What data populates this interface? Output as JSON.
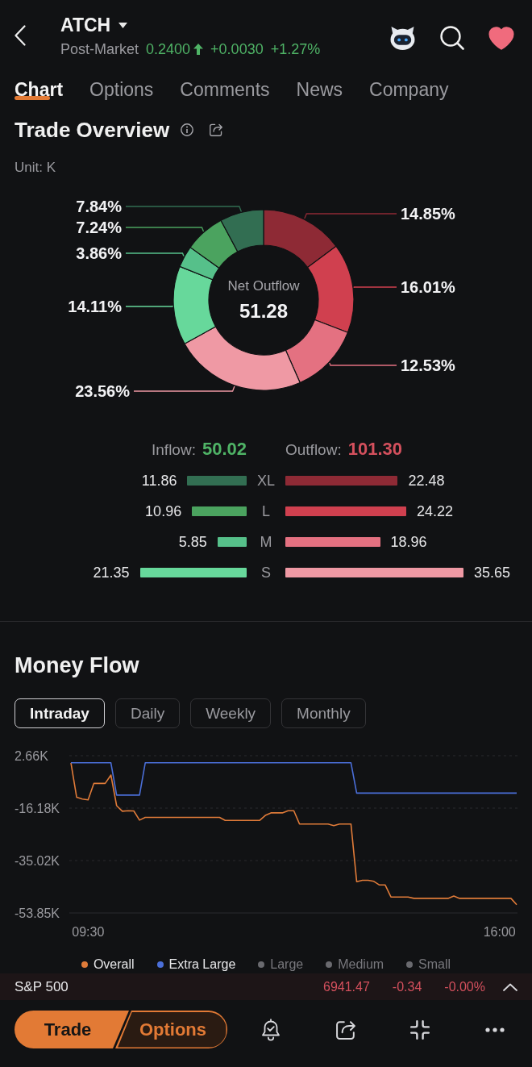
{
  "header": {
    "symbol": "ATCH",
    "session": "Post-Market",
    "price": "0.2400",
    "change": "+0.0030",
    "change_percent": "+1.27%",
    "favorited": true
  },
  "tabs": [
    {
      "label": "Chart",
      "selected": true
    },
    {
      "label": "Options",
      "selected": false
    },
    {
      "label": "Comments",
      "selected": false
    },
    {
      "label": "News",
      "selected": false
    },
    {
      "label": "Company",
      "selected": false
    }
  ],
  "trade_overview": {
    "title": "Trade Overview",
    "unit": "Unit: K",
    "center_label": "Net Outflow",
    "center_value": "51.28",
    "chart_data": {
      "type": "donut",
      "values": [
        14.85,
        16.01,
        12.53,
        23.56,
        14.11,
        3.86,
        7.24,
        7.84
      ],
      "value_labels": [
        "14.85%",
        "16.01%",
        "12.53%",
        "23.56%",
        "14.11%",
        "3.86%",
        "7.24%",
        "7.84%"
      ],
      "colors": [
        "#8e2a35",
        "#d0404f",
        "#e47181",
        "#ef99a4",
        "#67d89b",
        "#56c08a",
        "#4ba35f",
        "#326e52"
      ]
    }
  },
  "flows": {
    "inflow_label": "Inflow:",
    "inflow_total": "50.02",
    "outflow_label": "Outflow:",
    "outflow_total": "101.30",
    "rows": [
      {
        "size": "XL",
        "inflow": {
          "value": "11.86",
          "level": 0.333,
          "color": "#326e52"
        },
        "outflow": {
          "value": "22.48",
          "level": 0.631,
          "color": "#8e2a35"
        }
      },
      {
        "size": "L",
        "inflow": {
          "value": "10.96",
          "level": 0.307,
          "color": "#4ba35f"
        },
        "outflow": {
          "value": "24.22",
          "level": 0.679,
          "color": "#d0404f"
        }
      },
      {
        "size": "M",
        "inflow": {
          "value": "5.85",
          "level": 0.164,
          "color": "#56c08a"
        },
        "outflow": {
          "value": "18.96",
          "level": 0.532,
          "color": "#e47181"
        }
      },
      {
        "size": "S",
        "inflow": {
          "value": "21.35",
          "level": 0.599,
          "color": "#67d89b"
        },
        "outflow": {
          "value": "35.65",
          "level": 1.0,
          "color": "#ef99a4"
        }
      }
    ]
  },
  "money_flow": {
    "title": "Money Flow",
    "periods": [
      {
        "label": "Intraday",
        "selected": true
      },
      {
        "label": "Daily",
        "selected": false
      },
      {
        "label": "Weekly",
        "selected": false
      },
      {
        "label": "Monthly",
        "selected": false
      }
    ],
    "chart_data": {
      "type": "line",
      "categories": [
        null,
        null,
        null,
        "09:30",
        null,
        null,
        null,
        null,
        null,
        null,
        null,
        null,
        null,
        null,
        null,
        null,
        null,
        null,
        null,
        null,
        null,
        null,
        null,
        null,
        null,
        null,
        null,
        null,
        null,
        null,
        null,
        null,
        null,
        null,
        null,
        null,
        null,
        null,
        null,
        null,
        null,
        null,
        null,
        null,
        null,
        null,
        null,
        null,
        null,
        null,
        null,
        null,
        null,
        null,
        null,
        null,
        null,
        null,
        null,
        null,
        null,
        null,
        null,
        null,
        null,
        null,
        null,
        null,
        null,
        null,
        null,
        null,
        null,
        null,
        null,
        "16:00",
        null,
        null,
        null
      ],
      "series": [
        {
          "name": "Overall",
          "color": "#e07b39",
          "values": [
            0.1,
            -12.3,
            -12.9,
            -13.2,
            -7.3,
            -7.3,
            -7.3,
            -4.3,
            -15.3,
            -17.3,
            -17.1,
            -17.2,
            -20.5,
            -19.5,
            -19.5,
            -19.5,
            -19.5,
            -19.5,
            -19.5,
            -19.5,
            -19.5,
            -19.5,
            -19.5,
            -19.5,
            -19.5,
            -19.5,
            -19.5,
            -20.6,
            -20.6,
            -20.6,
            -20.6,
            -20.6,
            -20.6,
            -20.6,
            -18.8,
            -17.9,
            -17.9,
            -17.9,
            -17.1,
            -17.1,
            -21.9,
            -21.9,
            -21.9,
            -21.9,
            -21.9,
            -21.9,
            -22.5,
            -21.9,
            -21.9,
            -21.9,
            -42.6,
            -42.1,
            -42.1,
            -42.5,
            -43.8,
            -43.8,
            -48.1,
            -48.1,
            -48.1,
            -48.1,
            -48.6,
            -48.6,
            -48.6,
            -48.6,
            -48.6,
            -48.6,
            -48.6,
            -47.8,
            -48.6,
            -48.6,
            -48.6,
            -48.6,
            -48.6,
            -48.6,
            -48.6,
            -48.6,
            -48.6,
            -48.6,
            -50.9
          ]
        },
        {
          "name": "Extra Large",
          "color": "#4b6fd9",
          "values": [
            0.1,
            0.1,
            0.1,
            0.1,
            0.1,
            0.1,
            0.1,
            0.1,
            -11.5,
            -11.5,
            -11.5,
            -11.5,
            -11.5,
            0.1,
            0.1,
            0.1,
            0.1,
            0.1,
            0.1,
            0.1,
            0.1,
            0.1,
            0.1,
            0.1,
            0.1,
            0.1,
            0.1,
            0.1,
            0.1,
            0.1,
            0.1,
            0.1,
            0.1,
            0.1,
            0.1,
            0.1,
            0.1,
            0.1,
            0.1,
            0.1,
            0.1,
            0.1,
            0.1,
            0.1,
            0.1,
            0.1,
            0.1,
            0.1,
            0.1,
            0.1,
            -10.8,
            -10.8,
            -10.8,
            -10.8,
            -10.8,
            -10.8,
            -10.8,
            -10.8,
            -10.8,
            -10.8,
            -10.8,
            -10.8,
            -10.8,
            -10.8,
            -10.8,
            -10.8,
            -10.8,
            -10.8,
            -10.8,
            -10.8,
            -10.8,
            -10.8,
            -10.8,
            -10.8,
            -10.8,
            -10.8,
            -10.8,
            -10.8,
            -10.8
          ]
        }
      ],
      "ylim": [
        -53.85,
        2.66
      ],
      "yticks": [
        {
          "value": 2.66,
          "label": "2.66K"
        },
        {
          "value": -16.18,
          "label": "-16.18K"
        },
        {
          "value": -35.02,
          "label": "-35.02K"
        },
        {
          "value": -53.85,
          "label": "-53.85K"
        }
      ]
    },
    "legend": [
      {
        "label": "Large",
        "on": false
      },
      {
        "label": "Medium",
        "on": false
      },
      {
        "label": "Small",
        "on": false
      }
    ]
  },
  "index_bar": {
    "name": "S&P 500",
    "value": "6941.47",
    "change": "-0.34",
    "change_percent": "-0.00%"
  },
  "toolbar": {
    "trade": "Trade",
    "options": "Options"
  }
}
